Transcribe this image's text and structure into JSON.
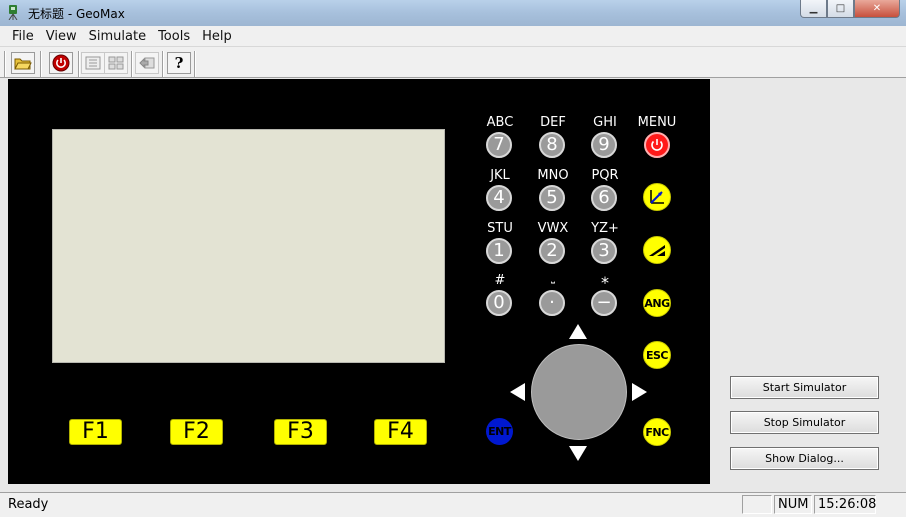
{
  "window": {
    "title": "无标题 - GeoMax",
    "minimize": "▁",
    "maximize": "□",
    "close": "✕"
  },
  "menu": [
    "File",
    "View",
    "Simulate",
    "Tools",
    "Help"
  ],
  "toolbar": {
    "icons": [
      "open-folder-icon",
      "power-icon",
      "list-icon",
      "grid-icon",
      "export-icon",
      "help-icon"
    ],
    "help_glyph": "?"
  },
  "device": {
    "function_keys": [
      "F1",
      "F2",
      "F3",
      "F4"
    ],
    "numpad": [
      {
        "label": "ABC",
        "digit": "7"
      },
      {
        "label": "DEF",
        "digit": "8"
      },
      {
        "label": "GHI",
        "digit": "9"
      },
      {
        "label": "JKL",
        "digit": "4"
      },
      {
        "label": "MNO",
        "digit": "5"
      },
      {
        "label": "PQR",
        "digit": "6"
      },
      {
        "label": "STU",
        "digit": "1"
      },
      {
        "label": "VWX",
        "digit": "2"
      },
      {
        "label": "YZ+",
        "digit": "3"
      },
      {
        "label": "#",
        "digit": "0"
      },
      {
        "label": "⎵",
        "digit": "·"
      },
      {
        "label": "*",
        "digit": "−"
      }
    ],
    "menu_label": "MENU",
    "ang_key": "ANG",
    "esc_key": "ESC",
    "fnc_key": "FNC",
    "ent_key": "ENT",
    "colors": {
      "yellow": "#ffff00",
      "power_red": "#ff1a1a",
      "ent_blue": "#0018d0",
      "key_grey": "#9a9a9a"
    }
  },
  "side_buttons": {
    "start": "Start Simulator",
    "stop": "Stop Simulator",
    "dialog": "Show Dialog..."
  },
  "status": {
    "text": "Ready",
    "num": "NUM",
    "time": "15:26:08"
  }
}
